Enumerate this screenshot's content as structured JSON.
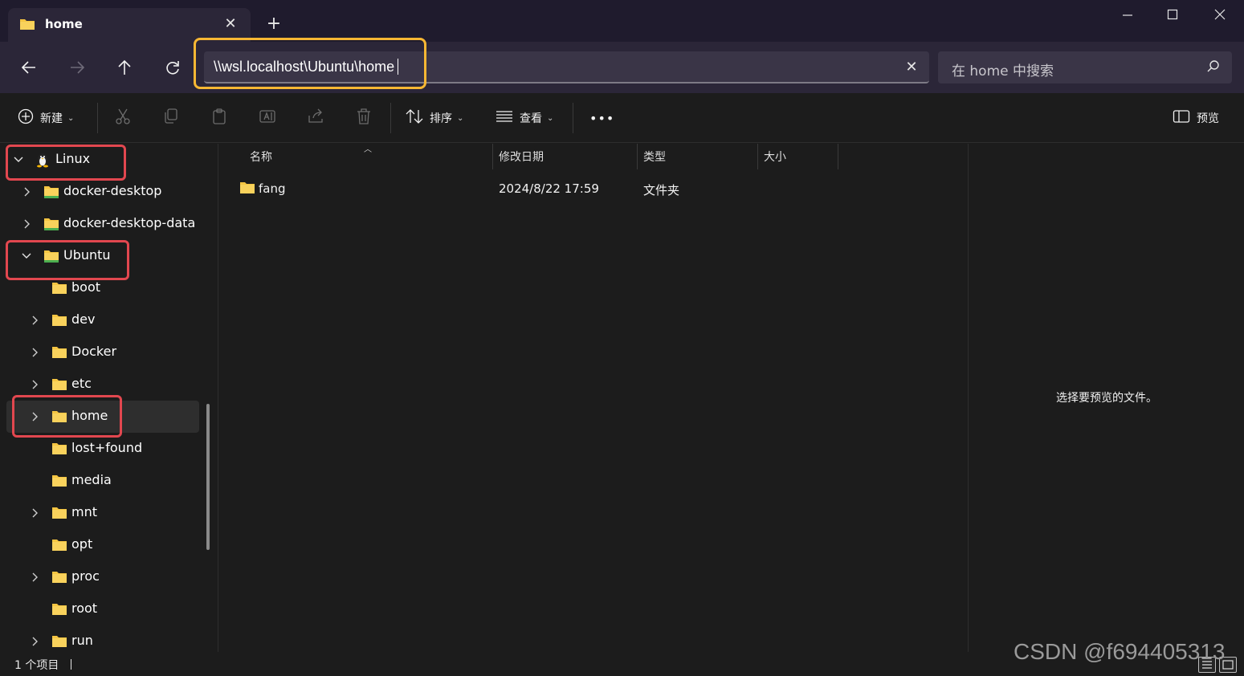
{
  "tab": {
    "title": "home"
  },
  "window": {
    "new_tab": "+"
  },
  "address": {
    "path": "\\\\wsl.localhost\\Ubuntu\\home"
  },
  "search": {
    "placeholder": "在 home 中搜索"
  },
  "toolbar": {
    "new_label": "新建",
    "sort_label": "排序",
    "view_label": "查看",
    "more_label": "•••",
    "preview_label": "预览"
  },
  "sidebar": {
    "items": [
      {
        "label": "Linux",
        "expanded": true
      },
      {
        "label": "docker-desktop",
        "expanded": false
      },
      {
        "label": "docker-desktop-data",
        "expanded": false
      },
      {
        "label": "Ubuntu",
        "expanded": true
      },
      {
        "label": "boot"
      },
      {
        "label": "dev"
      },
      {
        "label": "Docker"
      },
      {
        "label": "etc"
      },
      {
        "label": "home",
        "selected": true
      },
      {
        "label": "lost+found"
      },
      {
        "label": "media"
      },
      {
        "label": "mnt"
      },
      {
        "label": "opt"
      },
      {
        "label": "proc"
      },
      {
        "label": "root"
      },
      {
        "label": "run"
      }
    ]
  },
  "list": {
    "columns": [
      "名称",
      "修改日期",
      "类型",
      "大小"
    ],
    "rows": [
      {
        "name": "fang",
        "modified": "2024/8/22 17:59",
        "type": "文件夹",
        "size": ""
      }
    ]
  },
  "preview": {
    "empty_text": "选择要预览的文件。"
  },
  "status": {
    "count": "1 个项目"
  },
  "watermark": "CSDN @f694405313",
  "colors": {
    "folder": "#f5c542",
    "highlight_address": "#f7b733",
    "highlight_tree": "#e2474f"
  }
}
